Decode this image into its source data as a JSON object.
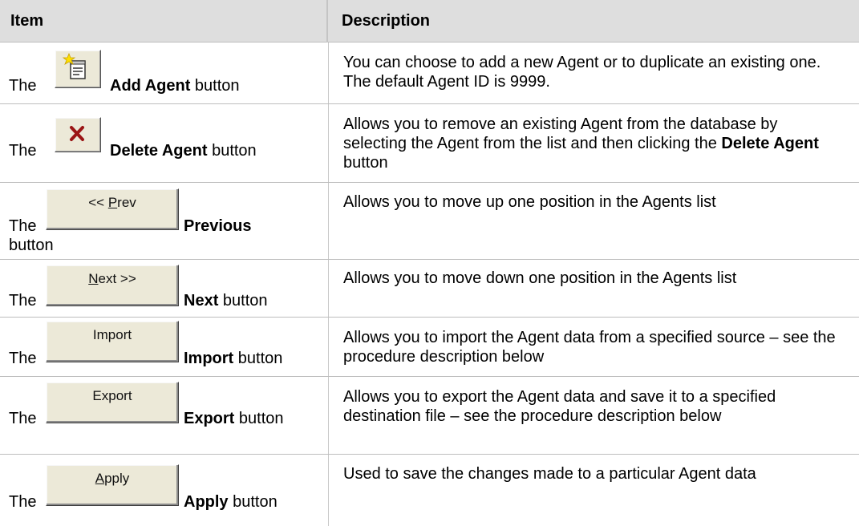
{
  "header": {
    "item": "Item",
    "description": "Description"
  },
  "rows": [
    {
      "the": "The",
      "name": "Add Agent",
      "suffix": " button",
      "icon": "add-agent-icon",
      "desc": "You can choose to add a new Agent or to duplicate an existing one. The default Agent ID is 9999."
    },
    {
      "the": "The",
      "name": "Delete Agent",
      "suffix": " button",
      "icon": "delete-x-icon",
      "desc_pre": "Allows you to remove an existing Agent from the database by selecting the Agent from the list and then clicking the ",
      "desc_bold": "Delete Agent",
      "desc_post": " button"
    },
    {
      "the": "The",
      "name": "Previous",
      "suffix": "button",
      "button_label_pre": "<< ",
      "button_label_u": "P",
      "button_label_post": "rev",
      "desc": "Allows you to move up one position in the Agents list"
    },
    {
      "the": "The",
      "name": "Next",
      "suffix": " button",
      "button_label_pre": "",
      "button_label_u": "N",
      "button_label_post": "ext >>",
      "desc": "Allows you to move down one position in the Agents list"
    },
    {
      "the": "The",
      "name": "Import",
      "suffix": " button",
      "button_label": "Import",
      "desc": "Allows you to import the Agent data from a specified source – see the procedure description below"
    },
    {
      "the": "The",
      "name": "Export",
      "suffix": " button",
      "button_label": "Export",
      "desc": "Allows you to export the Agent data and save it to a specified destination file – see the procedure description below"
    },
    {
      "the": "The",
      "name": "Apply",
      "suffix": " button",
      "button_label_pre": "",
      "button_label_u": "A",
      "button_label_post": "pply",
      "desc": "Used to save the changes made to a particular Agent data"
    }
  ]
}
